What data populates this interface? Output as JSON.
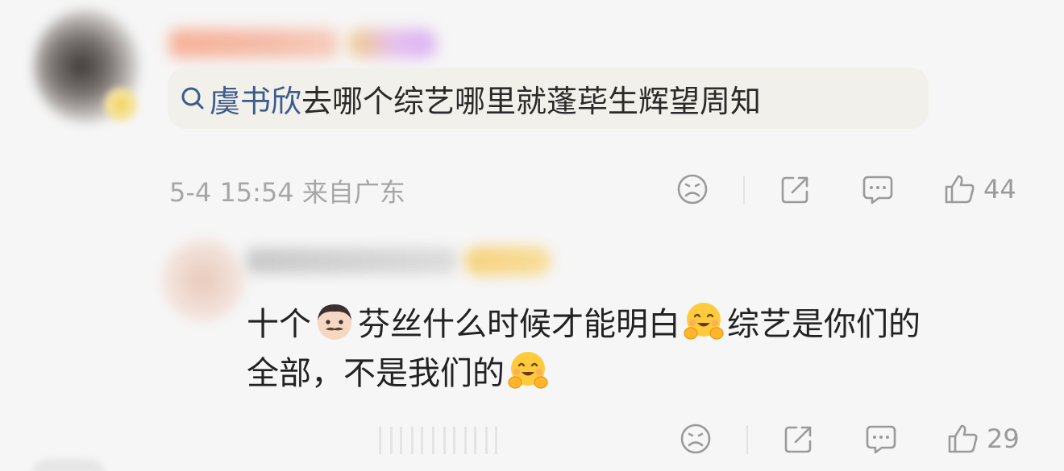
{
  "comment": {
    "text_keyword": "虞书欣",
    "text_rest": "去哪个综艺哪里就蓬荜生辉望周知",
    "meta": "5-4 15:54 来自广东",
    "like_count": "44",
    "icons": [
      "search-icon",
      "dislike-face-icon",
      "share-icon",
      "comment-icon",
      "like-icon"
    ]
  },
  "reply": {
    "line1_a": "十个",
    "line1_b": "芬丝什么时候才能明白",
    "line1_c": "综艺是你们的",
    "line2": "全部，不是我们的",
    "like_count": "29",
    "emojis": [
      "man-face-emoji",
      "hugging-face-emoji",
      "hugging-face-emoji"
    ]
  },
  "colors": {
    "background": "#f6f6f6",
    "chip_bg": "#f1f0ea",
    "keyword": "#3d5b8c",
    "meta": "#a6a6a6",
    "icon": "#9a9a9a"
  }
}
